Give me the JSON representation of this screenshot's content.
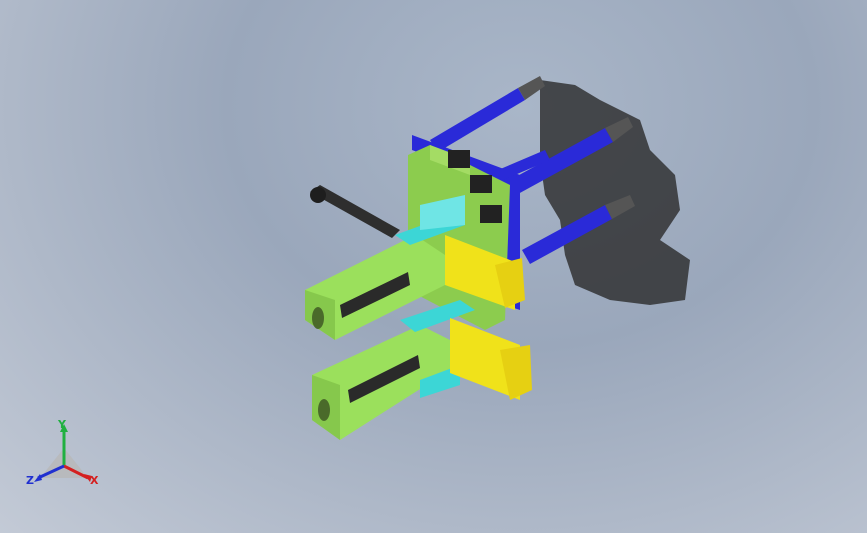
{
  "viewport": {
    "background_top": "#9aa7bb",
    "background_bottom": "#c3cad6"
  },
  "model": {
    "part_colors": {
      "frame_plate": "#9bd35a",
      "arm": "#9be05c",
      "cylinder": "#2a2ad8",
      "rod": "#6c6c6c",
      "clamp": "#f0e21a",
      "slider": "#3cd6d6",
      "shaft": "#2e2e2e",
      "shadow": "#2b2b2b"
    }
  },
  "triad": {
    "x_label": "X",
    "y_label": "Y",
    "z_label": "Z",
    "x_color": "#d42020",
    "y_color": "#20b040",
    "z_color": "#2030d0"
  }
}
